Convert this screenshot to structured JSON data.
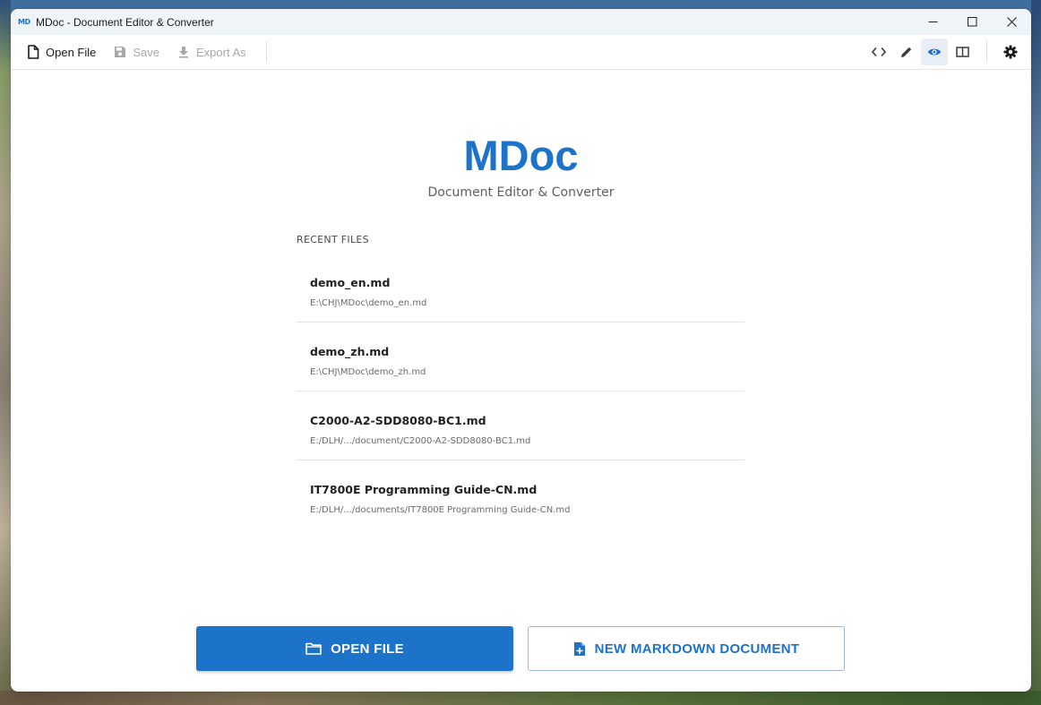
{
  "window": {
    "logo_text": "MD",
    "title": "MDoc - Document Editor & Converter"
  },
  "toolbar": {
    "open_file": "Open File",
    "save": "Save",
    "export_as": "Export As"
  },
  "view_modes": {
    "items": [
      "source-view",
      "edit-view",
      "preview-view",
      "split-view"
    ],
    "active": "preview-view"
  },
  "welcome": {
    "app_name": "MDoc",
    "subtitle": "Document Editor & Converter"
  },
  "recent": {
    "heading": "RECENT FILES",
    "items": [
      {
        "name": "demo_en.md",
        "path": "E:\\CHJ\\MDoc\\demo_en.md"
      },
      {
        "name": "demo_zh.md",
        "path": "E:\\CHJ\\MDoc\\demo_zh.md"
      },
      {
        "name": "C2000-A2-SDD8080-BC1.md",
        "path": "E:/DLH/.../document/C2000-A2-SDD8080-BC1.md"
      },
      {
        "name": "IT7800E Programming Guide-CN.md",
        "path": "E:/DLH/.../documents/IT7800E Programming Guide-CN.md"
      }
    ]
  },
  "actions": {
    "open_file": "OPEN FILE",
    "new_markdown": "NEW MARKDOWN DOCUMENT"
  },
  "colors": {
    "accent": "#1d72c9",
    "toolbar_disabled": "#a8a8a8"
  }
}
